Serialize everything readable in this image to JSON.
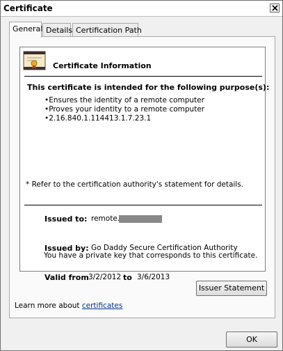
{
  "window": {
    "title": "Certificate"
  },
  "tabs": [
    {
      "label": "General"
    },
    {
      "label": "Details"
    },
    {
      "label": "Certification Path"
    }
  ],
  "panel": {
    "title": "Certificate Information",
    "purpose_heading": "This certificate is intended for the following purpose(s):",
    "purposes": [
      "Ensures the identity of a remote computer",
      "Proves your identity to a remote computer",
      "2.16.840.1.114413.1.7.23.1"
    ],
    "refer_note": "* Refer to the certification authority's statement for details.",
    "issued_to_label": "Issued to:",
    "issued_to_value": "remote.",
    "issued_by_label": "Issued by:",
    "issued_by_value": "Go Daddy Secure Certification Authority",
    "valid_from_label": "Valid from",
    "valid_from_value": "3/2/2012",
    "valid_to_label": "to",
    "valid_to_value": "3/6/2013",
    "private_key_note": "You have a private key that corresponds to this certificate."
  },
  "buttons": {
    "issuer_statement": "Issuer Statement",
    "ok": "OK"
  },
  "learn_more": {
    "prefix": "Learn more about",
    "link": "certificates"
  }
}
